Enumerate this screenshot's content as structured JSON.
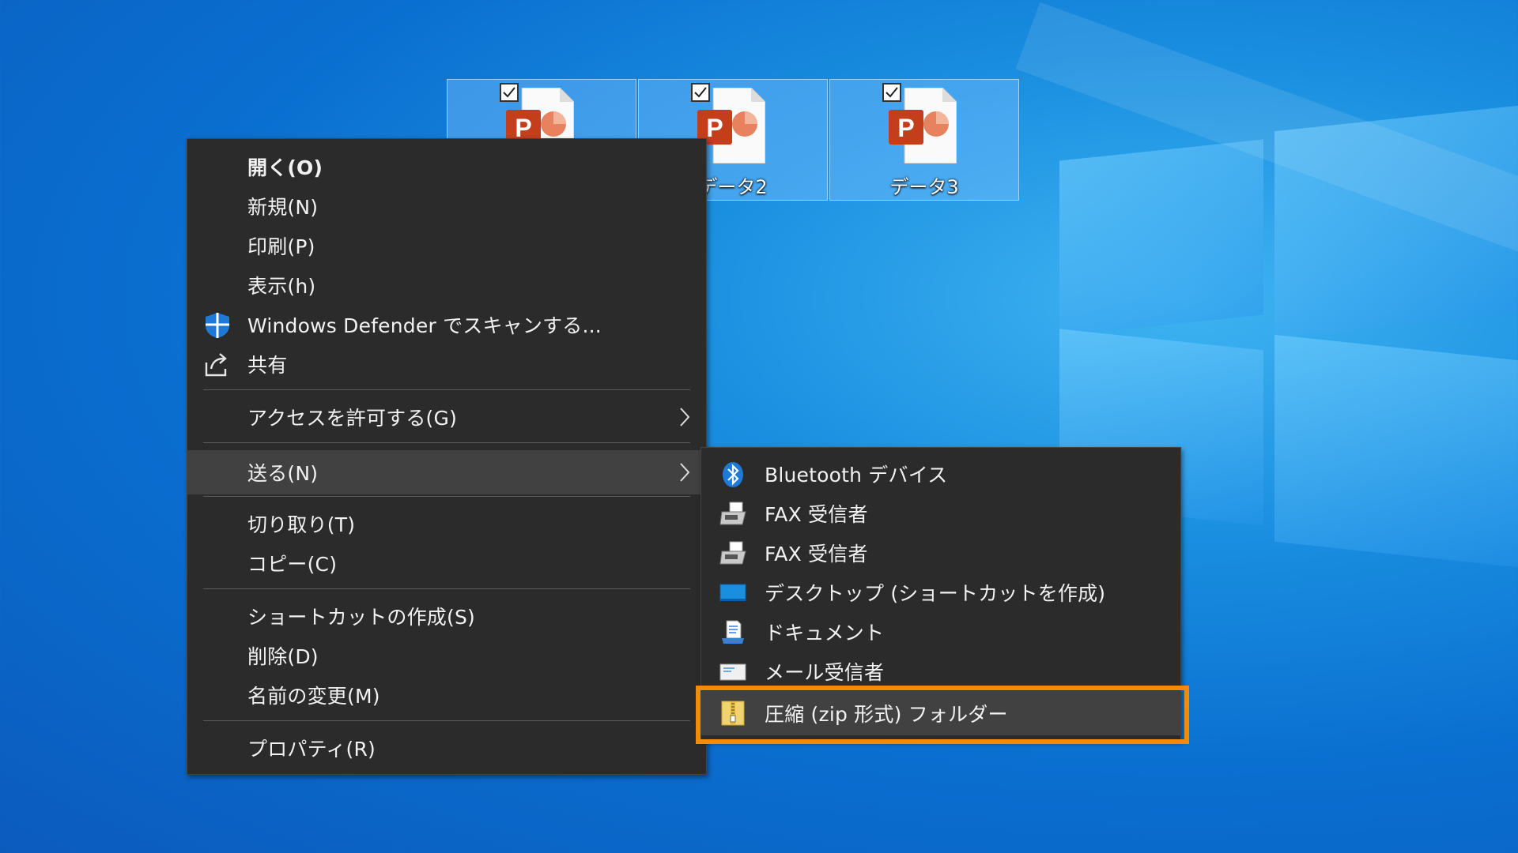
{
  "desktop": {
    "icons": [
      {
        "label": ""
      },
      {
        "label": "データ2"
      },
      {
        "label": "データ3"
      }
    ]
  },
  "context_menu": {
    "items": [
      {
        "label": "開く(O)",
        "bold": true
      },
      {
        "label": "新規(N)"
      },
      {
        "label": "印刷(P)"
      },
      {
        "label": "表示(h)"
      },
      {
        "label": "Windows Defender でスキャンする...",
        "icon": "defender-shield-icon"
      },
      {
        "label": "共有",
        "icon": "share-icon"
      },
      {
        "label": "アクセスを許可する(G)",
        "submenu": true
      },
      {
        "label": "送る(N)",
        "submenu": true,
        "highlighted": true
      },
      {
        "label": "切り取り(T)"
      },
      {
        "label": "コピー(C)"
      },
      {
        "label": "ショートカットの作成(S)"
      },
      {
        "label": "削除(D)"
      },
      {
        "label": "名前の変更(M)"
      },
      {
        "label": "プロパティ(R)"
      }
    ]
  },
  "send_to_menu": {
    "items": [
      {
        "label": "Bluetooth デバイス",
        "icon": "bluetooth-icon"
      },
      {
        "label": "FAX 受信者",
        "icon": "fax-icon"
      },
      {
        "label": "FAX 受信者",
        "icon": "fax-icon"
      },
      {
        "label": "デスクトップ (ショートカットを作成)",
        "icon": "desktop-icon"
      },
      {
        "label": "ドキュメント",
        "icon": "documents-icon"
      },
      {
        "label": "メール受信者",
        "icon": "mail-icon"
      },
      {
        "label": "圧縮 (zip 形式) フォルダー",
        "icon": "zip-folder-icon",
        "highlighted": true
      }
    ]
  },
  "colors": {
    "menu_bg": "#2b2b2b",
    "menu_hover": "#414141",
    "highlight_border": "#f58a07",
    "desktop_blue": "#0a6fd0"
  }
}
